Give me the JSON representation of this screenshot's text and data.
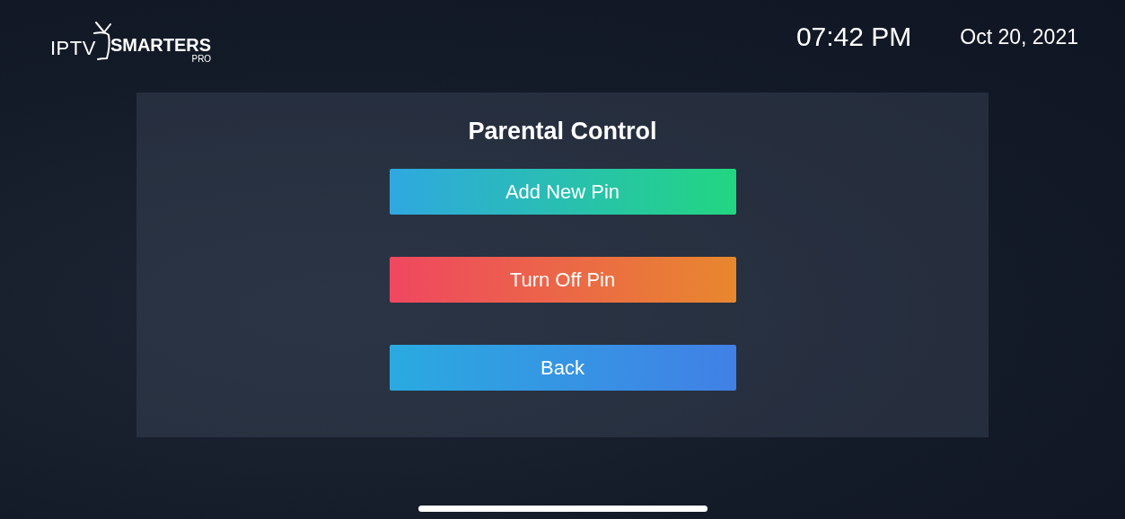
{
  "header": {
    "logo": {
      "prefix": "IPTV",
      "name": "SMARTERS",
      "suffix": "PRO"
    },
    "time": "07:42 PM",
    "date": "Oct 20, 2021"
  },
  "panel": {
    "title": "Parental Control",
    "buttons": [
      {
        "label": "Add New Pin",
        "kind": "primary"
      },
      {
        "label": "Turn Off Pin",
        "kind": "danger"
      },
      {
        "label": "Back",
        "kind": "secondary"
      }
    ]
  }
}
